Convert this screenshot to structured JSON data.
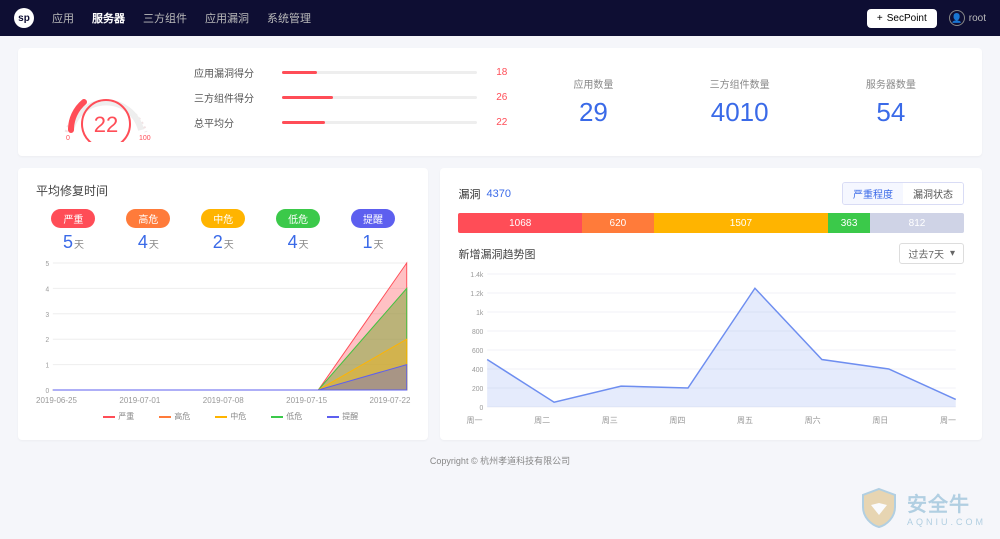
{
  "nav": {
    "items": [
      {
        "label": "应用",
        "active": false
      },
      {
        "label": "服务器",
        "active": true
      },
      {
        "label": "三方组件",
        "active": false
      },
      {
        "label": "应用漏洞",
        "active": false
      },
      {
        "label": "系统管理",
        "active": false
      }
    ],
    "secpoint_label": "SecPoint",
    "user": "root"
  },
  "gauge": {
    "score": "22",
    "min": "0",
    "max": "100"
  },
  "score_bars": [
    {
      "label": "应用漏洞得分",
      "value": "18",
      "percent": 18
    },
    {
      "label": "三方组件得分",
      "value": "26",
      "percent": 26
    },
    {
      "label": "总平均分",
      "value": "22",
      "percent": 22
    }
  ],
  "counts": [
    {
      "label": "应用数量",
      "value": "29"
    },
    {
      "label": "三方组件数量",
      "value": "4010"
    },
    {
      "label": "服务器数量",
      "value": "54"
    }
  ],
  "repair": {
    "title": "平均修复时间",
    "levels": [
      {
        "label": "严重",
        "days": "5",
        "color": "#ff4d57"
      },
      {
        "label": "高危",
        "days": "4",
        "color": "#ff7b3a"
      },
      {
        "label": "中危",
        "days": "2",
        "color": "#ffb400"
      },
      {
        "label": "低危",
        "days": "4",
        "color": "#3bc94a"
      },
      {
        "label": "提醒",
        "days": "1",
        "color": "#5d5fef"
      }
    ],
    "day_unit": "天",
    "x_axis": [
      "2019-06-25",
      "2019-07-01",
      "2019-07-08",
      "2019-07-15",
      "2019-07-22"
    ],
    "legend": [
      "严重",
      "高危",
      "中危",
      "低危",
      "提醒"
    ]
  },
  "vuln": {
    "title": "漏洞",
    "total": "4370",
    "toggle": {
      "left": "严重程度",
      "right": "漏洞状态"
    },
    "segments": [
      {
        "label": "1068",
        "color": "#ff4d57",
        "weight": 1068
      },
      {
        "label": "620",
        "color": "#ff7b3a",
        "weight": 620
      },
      {
        "label": "1507",
        "color": "#ffb400",
        "weight": 1507
      },
      {
        "label": "363",
        "color": "#3bc94a",
        "weight": 363
      },
      {
        "label": "812",
        "color": "#cfd3e6",
        "weight": 812
      }
    ],
    "trend_title": "新增漏洞趋势图",
    "range": "过去7天",
    "x_axis": [
      "周一",
      "周二",
      "周三",
      "周四",
      "周五",
      "周六",
      "周日",
      "周一"
    ]
  },
  "chart_data": [
    {
      "type": "area",
      "title": "平均修复时间",
      "x": [
        "2019-06-25",
        "2019-07-01",
        "2019-07-08",
        "2019-07-15",
        "2019-07-22"
      ],
      "ylim": [
        0,
        5
      ],
      "series": [
        {
          "name": "严重",
          "color": "#ff4d57",
          "values": [
            0,
            0,
            0,
            0,
            5
          ]
        },
        {
          "name": "高危",
          "color": "#ff7b3a",
          "values": [
            0,
            0,
            0,
            0,
            4
          ]
        },
        {
          "name": "中危",
          "color": "#ffb400",
          "values": [
            0,
            0,
            0,
            0,
            2
          ]
        },
        {
          "name": "低危",
          "color": "#3bc94a",
          "values": [
            0,
            0,
            0,
            0,
            4
          ]
        },
        {
          "name": "提醒",
          "color": "#5d5fef",
          "values": [
            0,
            0,
            0,
            0,
            1
          ]
        }
      ]
    },
    {
      "type": "line",
      "title": "新增漏洞趋势图",
      "x": [
        "周一",
        "周二",
        "周三",
        "周四",
        "周五",
        "周六",
        "周日",
        "周一"
      ],
      "ylim": [
        0,
        1400
      ],
      "y_ticks": [
        0,
        200,
        400,
        600,
        800,
        1000,
        1200,
        1400
      ],
      "series": [
        {
          "name": "新增漏洞",
          "color": "#6e8ef0",
          "values": [
            500,
            50,
            220,
            200,
            1250,
            500,
            400,
            80
          ]
        }
      ]
    }
  ],
  "footer": "Copyright © 杭州孝道科技有限公司",
  "watermark": {
    "brand": "安全牛",
    "domain": "AQNIU.COM"
  }
}
